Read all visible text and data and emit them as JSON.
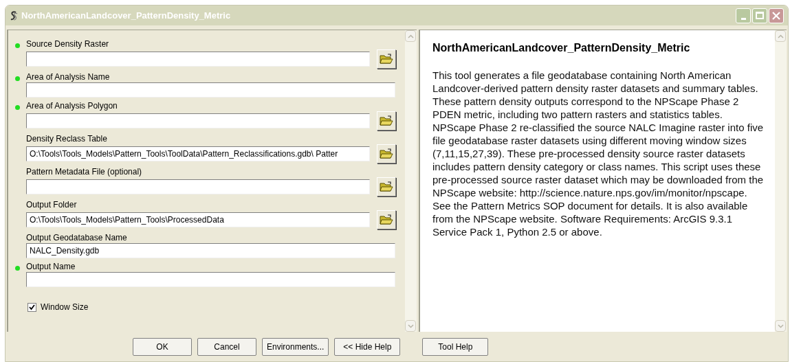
{
  "window": {
    "title": "NorthAmericanLandcover_PatternDensity_Metric"
  },
  "parameters": [
    {
      "label": "Source Density Raster",
      "required": true,
      "kind": "browse"
    },
    {
      "label": "Area of Analysis Name",
      "required": true,
      "kind": "text"
    },
    {
      "label": "Area of Analysis Polygon",
      "required": true,
      "kind": "browse"
    },
    {
      "label": "Density Reclass Table",
      "required": false,
      "value": "O:\\Tools\\Tools_Models\\Pattern_Tools\\ToolData\\Pattern_Reclassifications.gdb\\ Patter",
      "kind": "browse"
    },
    {
      "label": "Pattern Metadata File (optional)",
      "required": false,
      "kind": "browse"
    },
    {
      "label": "Output Folder",
      "required": false,
      "value": "O:\\Tools\\Tools_Models\\Pattern_Tools\\ProcessedData",
      "kind": "browse"
    },
    {
      "label": "Output Geodatabase Name",
      "required": false,
      "value": "NALC_Density.gdb",
      "kind": "text"
    },
    {
      "label": "Output Name",
      "required": true,
      "kind": "text"
    }
  ],
  "window_size": {
    "label": "Window Size",
    "checked": true
  },
  "help": {
    "title": "NorthAmericanLandcover_PatternDensity_Metric",
    "text": "This tool generates a file geodatabase containing North American Landcover-derived pattern density raster datasets and summary tables. These pattern density outputs correspond to the NPScape Phase 2 PDEN metric, including two pattern rasters and statistics tables. NPScape Phase 2 re-classified the source NALC Imagine raster into five file geodatabase raster datasets using different moving window sizes (7,11,15,27,39). These pre-processed density source raster datasets includes pattern density category or class names. This script uses these pre-processed source raster dataset which may be downloaded from the NPScape website: http://science.nature.nps.gov/im/monitor/npscape. See the Pattern Metrics SOP document for details. It is also available from the NPScape website. Software Requirements: ArcGIS 9.3.1 Service Pack 1, Python 2.5 or above."
  },
  "buttons": [
    {
      "label": "OK"
    },
    {
      "label": "Cancel"
    },
    {
      "label": "Environments..."
    },
    {
      "label": "<< Hide Help"
    },
    {
      "label": "Tool Help"
    }
  ]
}
